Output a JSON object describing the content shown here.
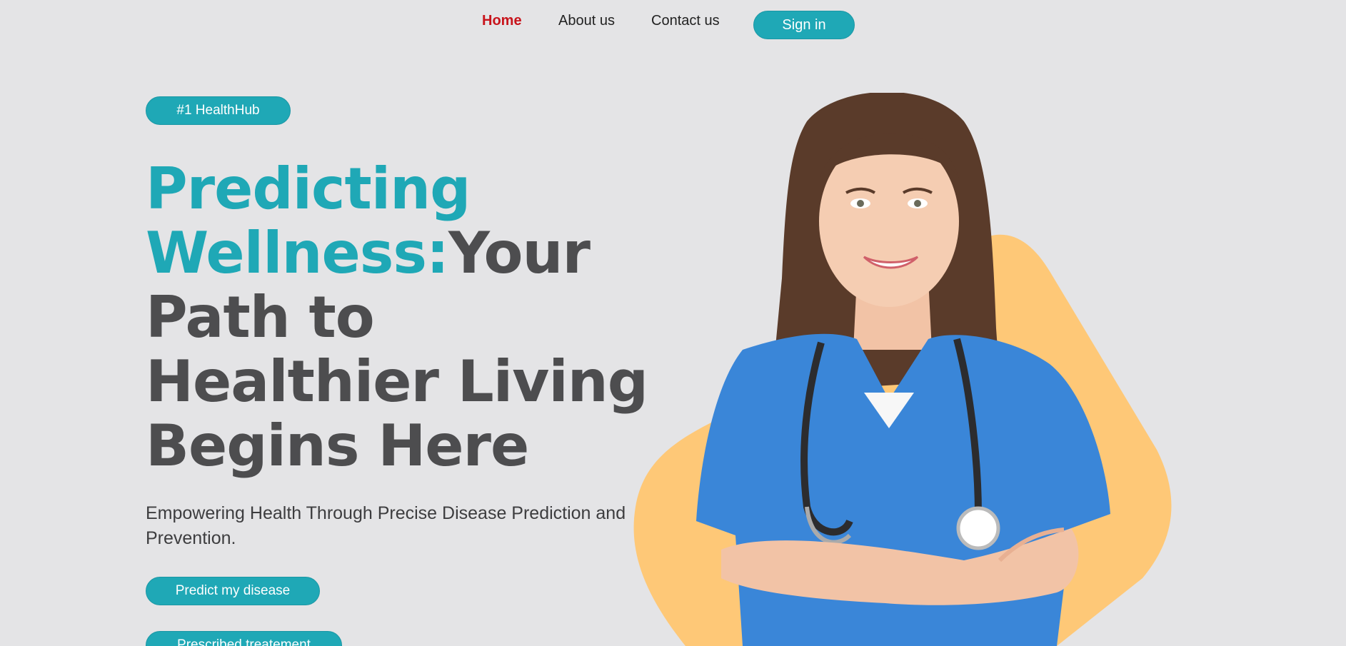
{
  "nav": {
    "links": [
      {
        "label": "Home",
        "active": true
      },
      {
        "label": "About us",
        "active": false
      },
      {
        "label": "Contact us",
        "active": false
      }
    ],
    "signin_label": "Sign in"
  },
  "hero": {
    "badge": "#1 HealthHub",
    "headline_accent": "Predicting Wellness:",
    "headline_rest": "Your Path to Healthier Living Begins Here",
    "subtext": "Empowering Health Through Precise Disease Prediction and Prevention.",
    "cta_predict": "Predict my disease",
    "cta_prescribed": "Prescribed treatement"
  },
  "colors": {
    "accent": "#1fa8b6",
    "active_nav": "#c8141c",
    "headline": "#4d4d4f",
    "blob": "#fec877",
    "scrubs": "#3a86d8",
    "background": "#e4e4e6"
  },
  "image": {
    "subject": "smiling doctor in blue scrubs with stethoscope, arms crossed"
  }
}
